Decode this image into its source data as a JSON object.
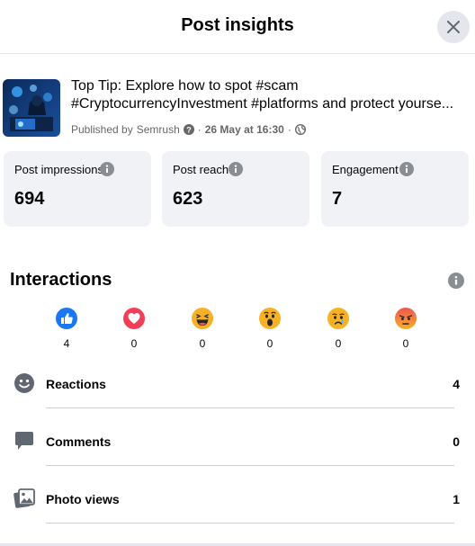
{
  "header": {
    "title": "Post insights",
    "close_icon": "close-icon"
  },
  "post": {
    "line1": "Top Tip: Explore how to spot #scam",
    "line2": "#CryptocurrencyInvestment #platforms and protect yourse...",
    "published_by_prefix": "Published by",
    "publisher": "Semrush",
    "separator1": "·",
    "date": "26 May at 16:30",
    "separator2": "·",
    "thumb_icon": "crypto-scam-thumbnail"
  },
  "metrics": [
    {
      "label": "Post impressions",
      "value": "694"
    },
    {
      "label": "Post reach",
      "value": "623"
    },
    {
      "label": "Engagement",
      "value": "7"
    }
  ],
  "interactions": {
    "title": "Interactions",
    "reactions": [
      {
        "icon": "like-icon",
        "count": "4"
      },
      {
        "icon": "love-icon",
        "count": "0"
      },
      {
        "icon": "haha-icon",
        "count": "0"
      },
      {
        "icon": "wow-icon",
        "count": "0"
      },
      {
        "icon": "sad-icon",
        "count": "0"
      },
      {
        "icon": "angry-icon",
        "count": "0"
      }
    ],
    "rows": [
      {
        "label": "Reactions",
        "value": "4",
        "icon": "smiley-icon"
      },
      {
        "label": "Comments",
        "value": "0",
        "icon": "comment-icon"
      },
      {
        "label": "Photo views",
        "value": "1",
        "icon": "photos-icon"
      }
    ]
  },
  "colors": {
    "like": "#1877f2",
    "love": "#f33e58",
    "emoji": "#f7b125",
    "angry": "#e9710f",
    "muted": "#65676b",
    "card_bg": "#f0f2f5"
  }
}
